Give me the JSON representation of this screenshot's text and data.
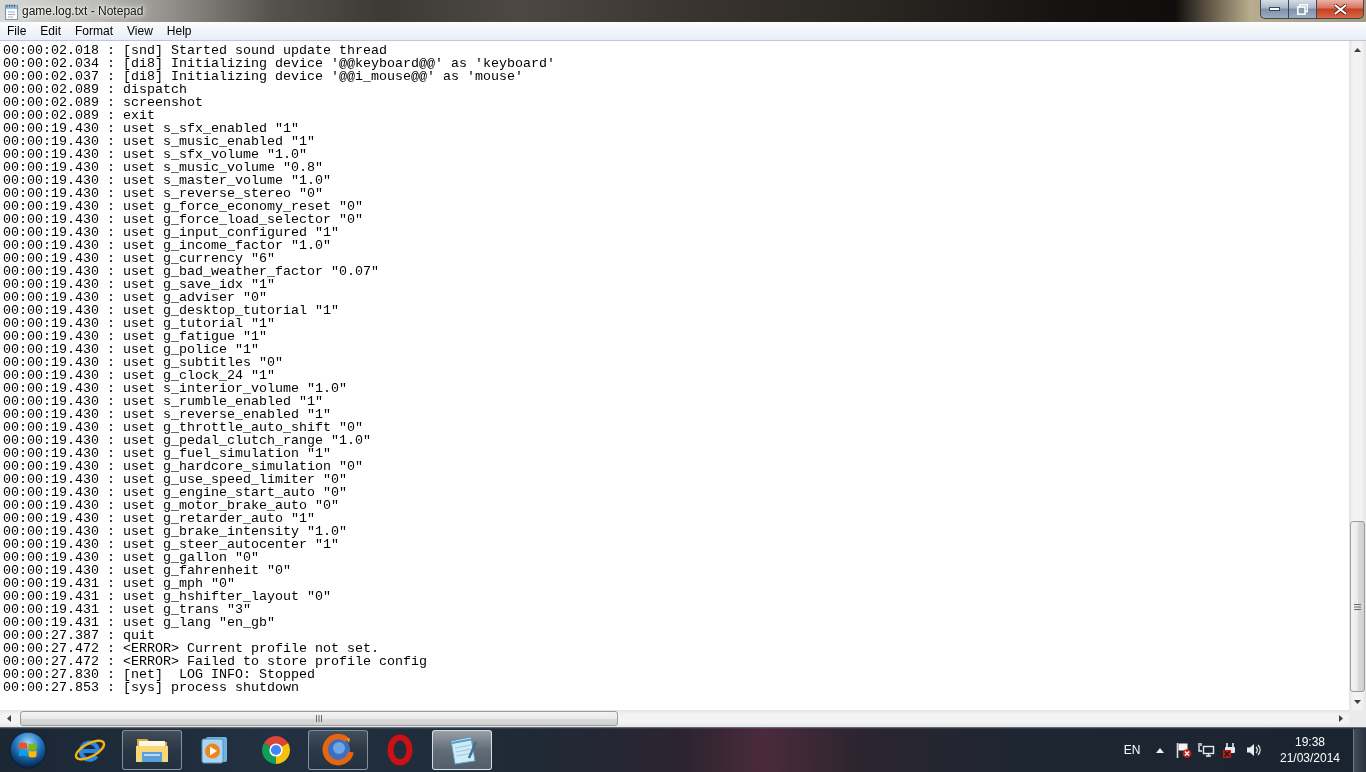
{
  "window": {
    "title": "game.log.txt - Notepad"
  },
  "menu": [
    "File",
    "Edit",
    "Format",
    "View",
    "Help"
  ],
  "editor": {
    "lines": [
      "00:00:02.018 : [snd] Started sound update thread",
      "00:00:02.034 : [di8] Initializing device '@@keyboard@@' as 'keyboard'",
      "00:00:02.037 : [di8] Initializing device '@@i_mouse@@' as 'mouse'",
      "00:00:02.089 : dispatch",
      "00:00:02.089 : screenshot",
      "00:00:02.089 : exit",
      "00:00:19.430 : uset s_sfx_enabled \"1\"",
      "00:00:19.430 : uset s_music_enabled \"1\"",
      "00:00:19.430 : uset s_sfx_volume \"1.0\"",
      "00:00:19.430 : uset s_music_volume \"0.8\"",
      "00:00:19.430 : uset s_master_volume \"1.0\"",
      "00:00:19.430 : uset s_reverse_stereo \"0\"",
      "00:00:19.430 : uset g_force_economy_reset \"0\"",
      "00:00:19.430 : uset g_force_load_selector \"0\"",
      "00:00:19.430 : uset g_input_configured \"1\"",
      "00:00:19.430 : uset g_income_factor \"1.0\"",
      "00:00:19.430 : uset g_currency \"6\"",
      "00:00:19.430 : uset g_bad_weather_factor \"0.07\"",
      "00:00:19.430 : uset g_save_idx \"1\"",
      "00:00:19.430 : uset g_adviser \"0\"",
      "00:00:19.430 : uset g_desktop_tutorial \"1\"",
      "00:00:19.430 : uset g_tutorial \"1\"",
      "00:00:19.430 : uset g_fatigue \"1\"",
      "00:00:19.430 : uset g_police \"1\"",
      "00:00:19.430 : uset g_subtitles \"0\"",
      "00:00:19.430 : uset g_clock_24 \"1\"",
      "00:00:19.430 : uset s_interior_volume \"1.0\"",
      "00:00:19.430 : uset s_rumble_enabled \"1\"",
      "00:00:19.430 : uset s_reverse_enabled \"1\"",
      "00:00:19.430 : uset g_throttle_auto_shift \"0\"",
      "00:00:19.430 : uset g_pedal_clutch_range \"1.0\"",
      "00:00:19.430 : uset g_fuel_simulation \"1\"",
      "00:00:19.430 : uset g_hardcore_simulation \"0\"",
      "00:00:19.430 : uset g_use_speed_limiter \"0\"",
      "00:00:19.430 : uset g_engine_start_auto \"0\"",
      "00:00:19.430 : uset g_motor_brake_auto \"0\"",
      "00:00:19.430 : uset g_retarder_auto \"1\"",
      "00:00:19.430 : uset g_brake_intensity \"1.0\"",
      "00:00:19.430 : uset g_steer_autocenter \"1\"",
      "00:00:19.430 : uset g_gallon \"0\"",
      "00:00:19.430 : uset g_fahrenheit \"0\"",
      "00:00:19.431 : uset g_mph \"0\"",
      "00:00:19.431 : uset g_hshifter_layout \"0\"",
      "00:00:19.431 : uset g_trans \"3\"",
      "00:00:19.431 : uset g_lang \"en_gb\"",
      "00:00:27.387 : quit",
      "00:00:27.472 : <ERROR> Current profile not set.",
      "00:00:27.472 : <ERROR> Failed to store profile config",
      "00:00:27.830 : [net]  LOG INFO: Stopped",
      "00:00:27.853 : [sys] process shutdown"
    ]
  },
  "taskbar": {
    "buttons": [
      {
        "kind": "ie",
        "running": false,
        "selected": false
      },
      {
        "kind": "explorer",
        "running": true,
        "selected": false
      },
      {
        "kind": "media",
        "running": false,
        "selected": false
      },
      {
        "kind": "chrome",
        "running": false,
        "selected": false
      },
      {
        "kind": "firefox",
        "running": true,
        "selected": false
      },
      {
        "kind": "opera",
        "running": false,
        "selected": false
      },
      {
        "kind": "notepad",
        "running": true,
        "selected": true
      }
    ],
    "tray": {
      "language": "EN",
      "time": "19:38",
      "date": "21/03/2014"
    }
  }
}
